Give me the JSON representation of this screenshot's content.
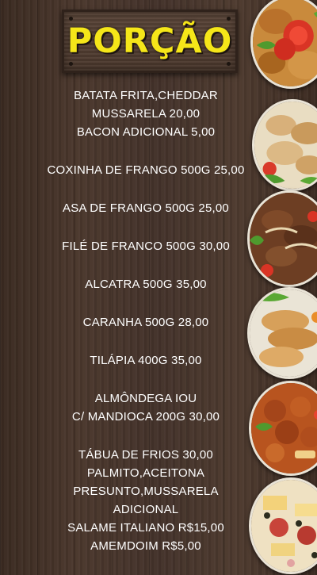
{
  "title": "PORÇÃO",
  "menu": [
    {
      "lines": [
        "BATATA FRITA,CHEDDAR",
        "MUSSARELA 20,00",
        "BACON ADICIONAL 5,00"
      ]
    },
    {
      "lines": [
        "COXINHA DE FRANGO 500G 25,00"
      ]
    },
    {
      "lines": [
        "ASA DE FRANGO 500G 25,00"
      ]
    },
    {
      "lines": [
        "FILÉ DE FRANCO 500G 30,00"
      ]
    },
    {
      "lines": [
        "ALCATRA 500G 35,00"
      ]
    },
    {
      "lines": [
        "CARANHA 500G 28,00"
      ]
    },
    {
      "lines": [
        "TILÁPIA 400G 35,00"
      ]
    },
    {
      "lines": [
        "ALMÔNDEGA IOU",
        "C/ MANDIOCA 200G 30,00"
      ]
    },
    {
      "lines": [
        "TÁBUA DE FRIOS 30,00",
        "PALMITO,ACEITONA",
        "PRESUNTO,MUSSARELA",
        "ADICIONAL",
        "SALAME ITALIANO R$15,00",
        "AMEMDOIM R$5,00"
      ]
    }
  ],
  "photos": [
    {
      "name": "fried-chicken-tomato-photo"
    },
    {
      "name": "chicken-wings-photo"
    },
    {
      "name": "beef-onion-photo"
    },
    {
      "name": "fried-fish-photo"
    },
    {
      "name": "meatballs-photo"
    },
    {
      "name": "cold-cuts-board-photo"
    }
  ]
}
